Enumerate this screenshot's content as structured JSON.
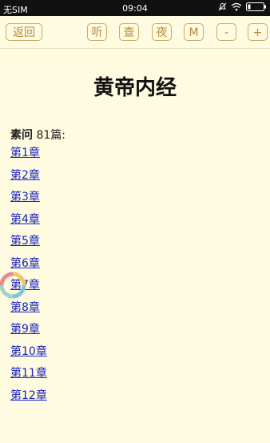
{
  "status_bar": {
    "carrier": "无SIM",
    "time": "09:04"
  },
  "toolbar": {
    "back_label": "返回",
    "listen_label": "听",
    "search_label": "查",
    "night_label": "夜",
    "menu_label": "M",
    "decrease_label": "-",
    "increase_label": "+"
  },
  "page": {
    "title": "黄帝内经",
    "section_name": "素问",
    "section_count": "81篇:"
  },
  "chapters": [
    "第1章",
    "第2章",
    "第3章",
    "第4章",
    "第5章",
    "第6章",
    "第7章",
    "第8章",
    "第9章",
    "第10章",
    "第11章",
    "第12章"
  ],
  "colors": {
    "background": "#fefbe0",
    "button_border": "#c9a86a",
    "button_text": "#b8893d",
    "link": "#1a22c0"
  }
}
